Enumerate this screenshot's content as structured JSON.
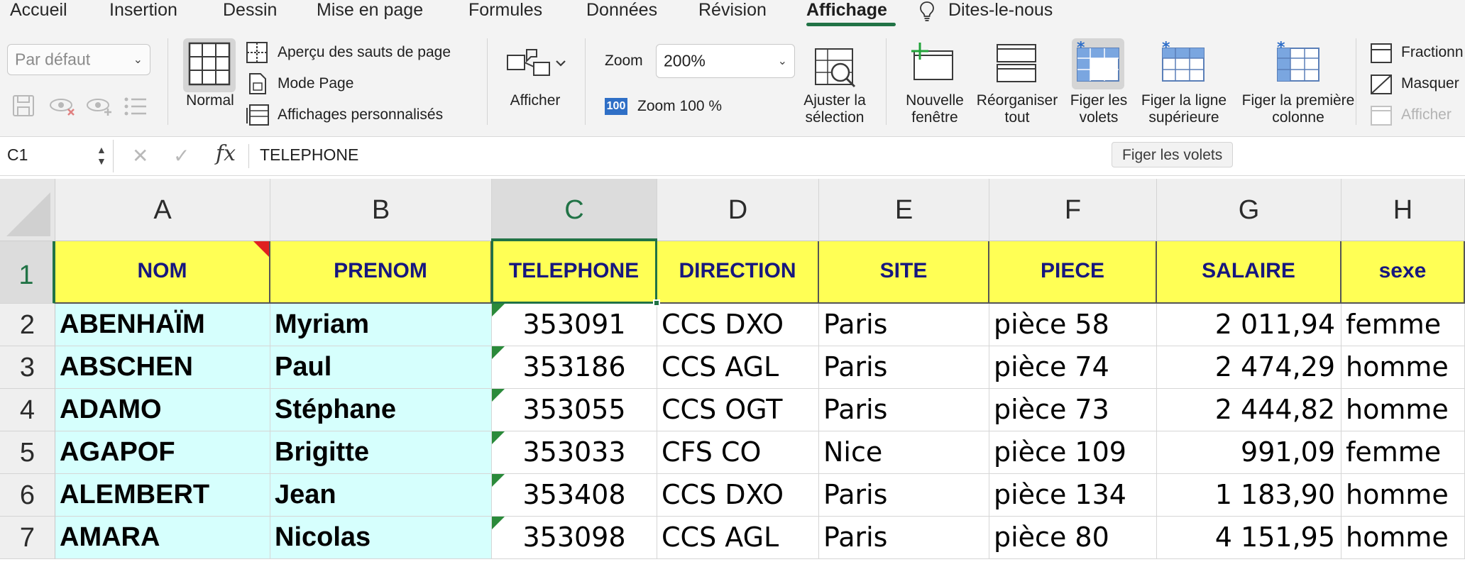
{
  "tabs": [
    "Accueil",
    "Insertion",
    "Dessin",
    "Mise en page",
    "Formules",
    "Données",
    "Révision",
    "Affichage",
    "Dites-le-nous"
  ],
  "active_tab": "Affichage",
  "ribbon": {
    "sheet_view_value": "Par défaut",
    "normal_label": "Normal",
    "apercu_label": "Aperçu des sauts de page",
    "mode_page_label": "Mode Page",
    "affichages_label": "Affichages personnalisés",
    "afficher_label": "Afficher",
    "zoom_label": "Zoom",
    "zoom_value": "200%",
    "zoom100_badge": "100",
    "zoom100_label": "Zoom 100 %",
    "ajuster_l1": "Ajuster la",
    "ajuster_l2": "sélection",
    "nouvelle_l1": "Nouvelle",
    "nouvelle_l2": "fenêtre",
    "reorganiser_l1": "Réorganiser",
    "reorganiser_l2": "tout",
    "figer_l1": "Figer les",
    "figer_l2": "volets",
    "figer_ligne_l1": "Figer la ligne",
    "figer_ligne_l2": "supérieure",
    "figer_col_l1": "Figer la première",
    "figer_col_l2": "colonne",
    "fractionner_label": "Fractionn",
    "masquer_label": "Masquer",
    "afficher2_label": "Afficher"
  },
  "formula_bar": {
    "name_box": "C1",
    "fx": "fx",
    "value": "TELEPHONE"
  },
  "tooltip": "Figer les volets",
  "columns": [
    "A",
    "B",
    "C",
    "D",
    "E",
    "F",
    "G",
    "H"
  ],
  "selected_column": "C",
  "rows": [
    "1",
    "2",
    "3",
    "4",
    "5",
    "6",
    "7"
  ],
  "header_row": [
    "NOM",
    "PRENOM",
    "TELEPHONE",
    "DIRECTION",
    "SITE",
    "PIECE",
    "SALAIRE",
    "sexe"
  ],
  "data_rows": [
    [
      "ABENHAÏM",
      "Myriam",
      "353091",
      "CCS DXO",
      "Paris",
      "pièce 58",
      "2 011,94",
      "femme"
    ],
    [
      "ABSCHEN",
      "Paul",
      "353186",
      "CCS AGL",
      "Paris",
      "pièce 74",
      "2 474,29",
      "homme"
    ],
    [
      "ADAMO",
      "Stéphane",
      "353055",
      "CCS OGT",
      "Paris",
      "pièce 73",
      "2 444,82",
      "homme"
    ],
    [
      "AGAPOF",
      "Brigitte",
      "353033",
      "CFS CO",
      "Nice",
      "pièce 109",
      "991,09",
      "femme"
    ],
    [
      "ALEMBERT",
      "Jean",
      "353408",
      "CCS DXO",
      "Paris",
      "pièce 134",
      "1 183,90",
      "homme"
    ],
    [
      "AMARA",
      "Nicolas",
      "353098",
      "CCS AGL",
      "Paris",
      "pièce 80",
      "4 151,95",
      "homme"
    ]
  ],
  "colors": {
    "accent": "#217346",
    "header_fill": "#ffff55",
    "header_text": "#17177f",
    "name_fill": "#d6fffd"
  }
}
